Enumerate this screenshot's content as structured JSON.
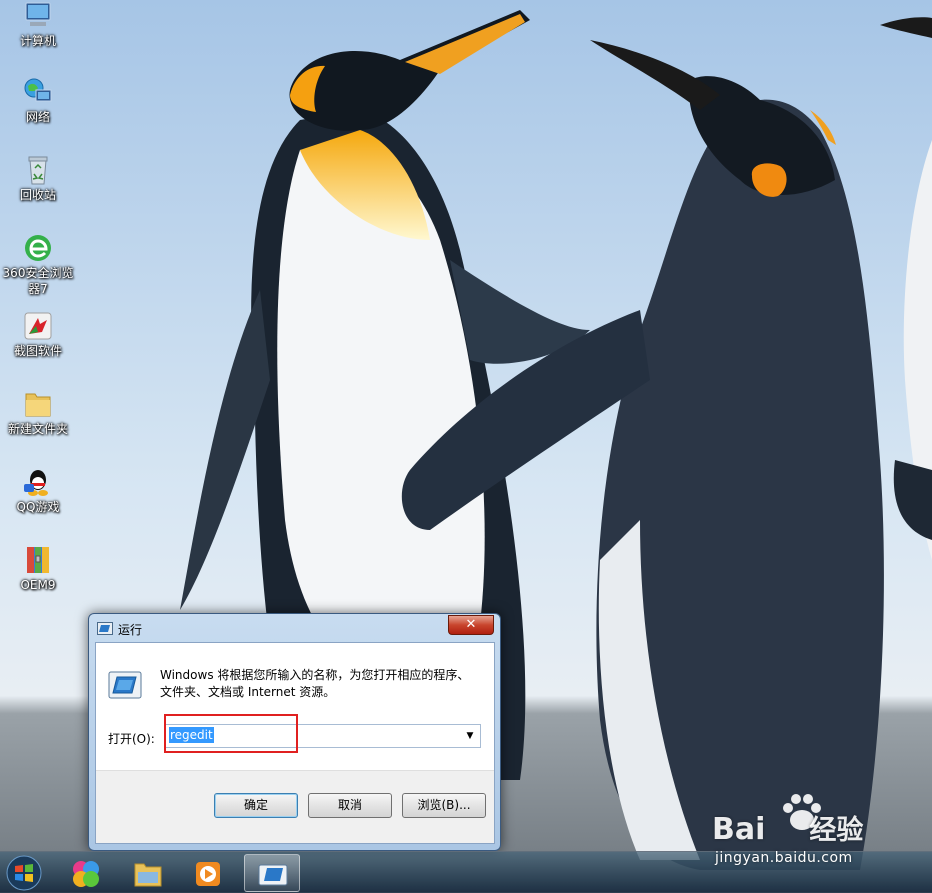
{
  "desktop": {
    "icons": [
      {
        "label": "计算机",
        "icon": "computer-icon"
      },
      {
        "label": "网络",
        "icon": "network-icon"
      },
      {
        "label": "回收站",
        "icon": "recycle-bin-icon"
      },
      {
        "label": "360安全浏览器7",
        "icon": "browser-360-icon"
      },
      {
        "label": "截图软件",
        "icon": "screenshot-app-icon"
      },
      {
        "label": "新建文件夹",
        "icon": "folder-icon"
      },
      {
        "label": "QQ游戏",
        "icon": "qq-games-icon"
      },
      {
        "label": "OEM9",
        "icon": "archive-icon"
      }
    ]
  },
  "run_dialog": {
    "title": "运行",
    "close_glyph": "✕",
    "description": "Windows 将根据您所输入的名称，为您打开相应的程序、文件夹、文档或 Internet 资源。",
    "open_label": "打开(O):",
    "open_value": "regedit",
    "ok_label": "确定",
    "cancel_label": "取消",
    "browse_label": "浏览(B)..."
  },
  "taskbar": {
    "items": [
      "start-orb-icon",
      "media-center-icon",
      "explorer-icon",
      "media-player-icon",
      "run-icon"
    ]
  },
  "watermark": {
    "brand": "Bai",
    "brand_cn": "经验",
    "url": "jingyan.baidu.com"
  },
  "colors": {
    "highlight": "#e02020",
    "selection": "#3399ff"
  }
}
